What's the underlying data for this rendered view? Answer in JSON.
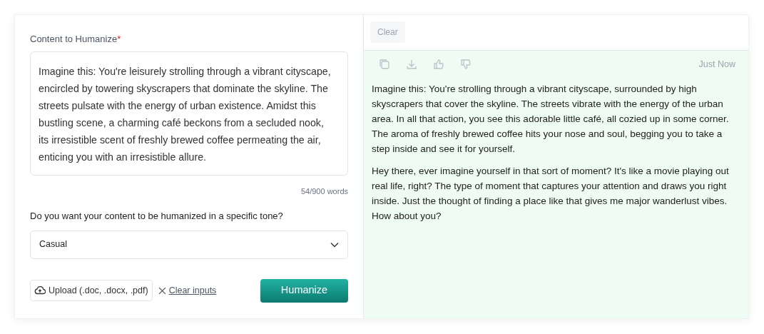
{
  "input_panel": {
    "label": "Content to Humanize",
    "required_mark": "*",
    "content": "Imagine this: You're leisurely strolling through a vibrant cityscape, encircled by towering skyscrapers that dominate the skyline. The streets pulsate with the energy of urban existence. Amidst this bustling scene, a charming café beckons from a secluded nook, its irresistible scent of freshly brewed coffee permeating the air, enticing you with an irresistible allure.",
    "word_count": "54/900 words",
    "tone_question": "Do you want your content to be humanized in a specific tone?",
    "tone_value": "Casual",
    "upload_button": "Upload (.doc, .docx, .pdf)",
    "clear_inputs": "Clear inputs",
    "humanize_button": "Humanize"
  },
  "output_panel": {
    "clear_button": "Clear",
    "toolbar": [
      {
        "kind": "copy"
      },
      {
        "kind": "download"
      },
      {
        "kind": "like"
      },
      {
        "kind": "dislike"
      }
    ],
    "timestamp": "Just Now",
    "paragraphs": [
      "Imagine this: You're strolling through a vibrant cityscape, surrounded by high skyscrapers that cover the skyline. The streets vibrate with the energy of the urban area. In all that action, you see this adorable little café, all cozied up in some corner. The aroma of freshly brewed coffee hits your nose and soul, begging you to take a step inside and see it for yourself.",
      "Hey there, ever imagine yourself in that sort of moment? It's like a movie playing out real life, right? The type of moment that captures your attention and draws you right inside. Just the thought of finding a place like that gives me major wanderlust vibes. How about you?"
    ]
  }
}
